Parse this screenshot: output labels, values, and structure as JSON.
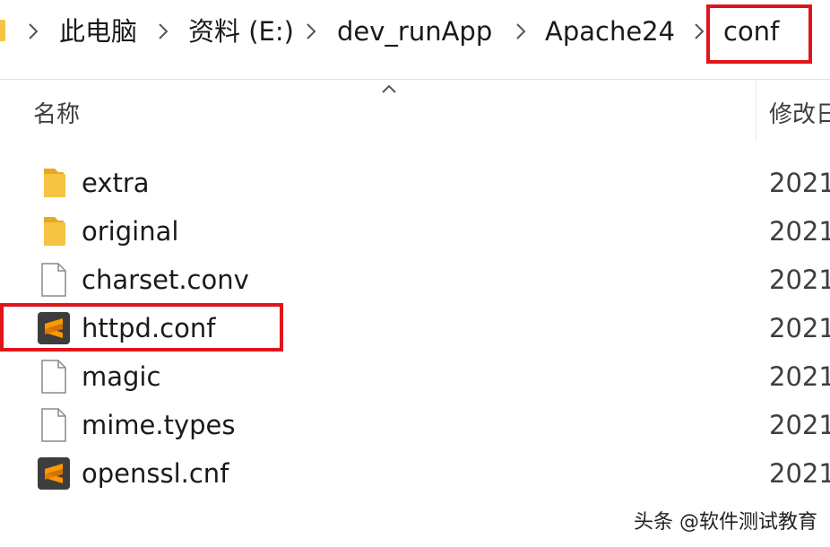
{
  "breadcrumb": {
    "items": [
      {
        "label": "此电脑"
      },
      {
        "label": "资料 (E:)"
      },
      {
        "label": "dev_runApp"
      },
      {
        "label": "Apache24"
      },
      {
        "label": "conf"
      }
    ]
  },
  "columns": {
    "name": "名称",
    "modified": "修改日"
  },
  "files": [
    {
      "name": "extra",
      "type": "folder",
      "date": "2021"
    },
    {
      "name": "original",
      "type": "folder",
      "date": "2021"
    },
    {
      "name": "charset.conv",
      "type": "file",
      "date": "2021"
    },
    {
      "name": "httpd.conf",
      "type": "sublime",
      "date": "2021"
    },
    {
      "name": "magic",
      "type": "file",
      "date": "2021"
    },
    {
      "name": "mime.types",
      "type": "file",
      "date": "2021"
    },
    {
      "name": "openssl.cnf",
      "type": "sublime",
      "date": "2021"
    }
  ],
  "watermark": "头条 @软件测试教育",
  "colors": {
    "highlight": "#e0151b",
    "folder": "#f6c343",
    "sublime_bg": "#3d3d3d",
    "sublime_s": "#ff9800"
  },
  "icons": {
    "folder": "folder-icon",
    "file": "file-icon",
    "sublime": "sublime-text-icon",
    "separator": "chevron-right-icon",
    "sort": "chevron-up-icon"
  }
}
